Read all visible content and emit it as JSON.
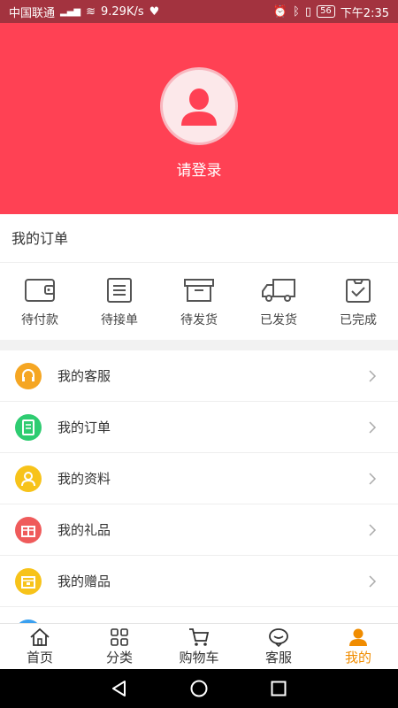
{
  "status_bar": {
    "carrier": "中国联通",
    "network_speed": "9.29K/s",
    "battery": "56",
    "time": "下午2:35"
  },
  "header": {
    "login_label": "请登录"
  },
  "orders": {
    "title": "我的订单",
    "items": [
      {
        "label": "待付款",
        "icon": "wallet-icon"
      },
      {
        "label": "待接单",
        "icon": "list-icon"
      },
      {
        "label": "待发货",
        "icon": "box-icon"
      },
      {
        "label": "已发货",
        "icon": "truck-icon"
      },
      {
        "label": "已完成",
        "icon": "clipboard-check-icon"
      }
    ]
  },
  "menu": {
    "items": [
      {
        "label": "我的客服",
        "icon": "headset-icon",
        "color": "#f5a623"
      },
      {
        "label": "我的订单",
        "icon": "document-icon",
        "color": "#2ecc71"
      },
      {
        "label": "我的资料",
        "icon": "profile-icon",
        "color": "#f7c31a"
      },
      {
        "label": "我的礼品",
        "icon": "gift-icon",
        "color": "#ef5b5b"
      },
      {
        "label": "我的赠品",
        "icon": "giftbox-icon",
        "color": "#f7c31a"
      }
    ]
  },
  "tabbar": {
    "items": [
      {
        "label": "首页",
        "icon": "home-icon"
      },
      {
        "label": "分类",
        "icon": "grid-icon"
      },
      {
        "label": "购物车",
        "icon": "cart-icon"
      },
      {
        "label": "客服",
        "icon": "chat-icon"
      },
      {
        "label": "我的",
        "icon": "user-icon",
        "active": true
      }
    ]
  },
  "colors": {
    "header_bg": "#ff4154",
    "status_bg": "#a3333f",
    "active_tab": "#f08c00"
  }
}
